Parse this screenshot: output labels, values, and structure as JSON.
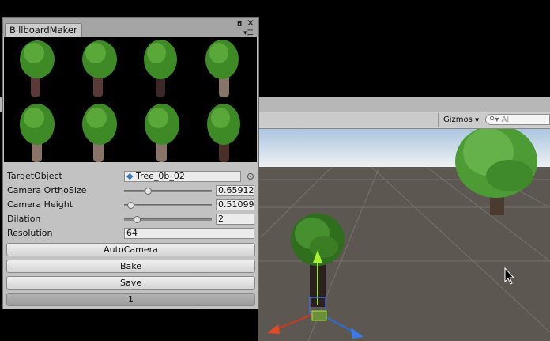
{
  "scene": {
    "gizmos_label": "Gizmos",
    "search_placeholder": "All"
  },
  "panel": {
    "tab_title": "BillboardMaker",
    "properties": {
      "target_object": {
        "label": "TargetObject",
        "value": "Tree_0b_02"
      },
      "camera_ortho_size": {
        "label": "Camera OrthoSize",
        "value": "0.65912",
        "level": 0.25
      },
      "camera_height": {
        "label": "Camera Height",
        "value": "0.51099",
        "level": 0.04
      },
      "dilation": {
        "label": "Dilation",
        "value": "2",
        "level": 0.12
      },
      "resolution": {
        "label": "Resolution",
        "value": "64"
      }
    },
    "buttons": {
      "auto_camera": "AutoCamera",
      "bake": "Bake",
      "save": "Save",
      "page": "1"
    }
  },
  "colors": {
    "panel_bg": "#c2c2c2",
    "tree_green": "#3f8a2a",
    "trunk_brown": "#4a2e28",
    "sky": "#e8eef4",
    "ground": "#5d5752"
  }
}
